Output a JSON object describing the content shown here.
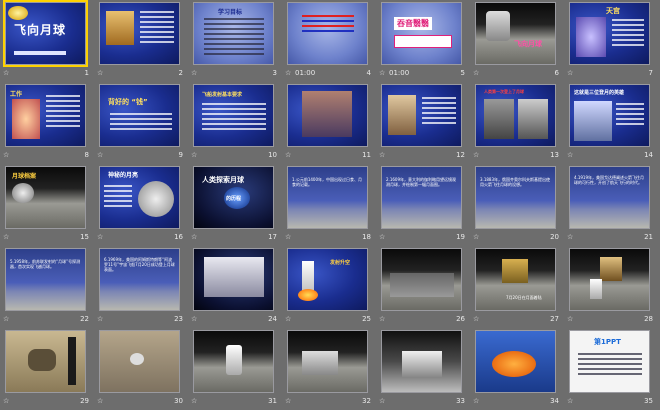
{
  "slides": [
    {
      "number": "1",
      "timing": "",
      "title": "飞向月球"
    },
    {
      "number": "2",
      "timing": ""
    },
    {
      "number": "3",
      "timing": "",
      "title": "学习目标"
    },
    {
      "number": "4",
      "timing": "01:00"
    },
    {
      "number": "5",
      "timing": "01:00",
      "title": "吞音翳翳"
    },
    {
      "number": "6",
      "timing": "",
      "title": "飞向月球"
    },
    {
      "number": "7",
      "timing": "",
      "title": "天宫"
    },
    {
      "number": "8",
      "timing": "",
      "title": "工作"
    },
    {
      "number": "9",
      "timing": "",
      "title": "背好的 “钱”"
    },
    {
      "number": "10",
      "timing": "",
      "title": "飞船发射基本要求"
    },
    {
      "number": "11",
      "timing": ""
    },
    {
      "number": "12",
      "timing": ""
    },
    {
      "number": "13",
      "timing": "",
      "title": "人类第一次登上了月球"
    },
    {
      "number": "14",
      "timing": "",
      "title": "这就是三位登月的英雄"
    },
    {
      "number": "15",
      "timing": "",
      "title": "月球档案"
    },
    {
      "number": "16",
      "timing": "",
      "title": "神秘的月亮"
    },
    {
      "number": "17",
      "timing": "",
      "title": "人类探索月球",
      "subtitle": "的历程"
    },
    {
      "number": "18",
      "timing": "",
      "text": "1.公元前1400年，中国出现过日食、月食的记载。"
    },
    {
      "number": "19",
      "timing": "",
      "text": "2.1609年，意大利的伽利略用望远镜观测月球，并绘制第一幅月面图。"
    },
    {
      "number": "20",
      "timing": "",
      "text": "3.1883年，俄国齐奥尔科夫斯基提出使用火箭飞往月球的设想。"
    },
    {
      "number": "21",
      "timing": "",
      "text": "4.1919年，美国戈达德阐述火箭飞往月球的可行性，开创了航天飞行的时代。"
    },
    {
      "number": "22",
      "timing": "",
      "text": "5.1958年，前苏联发射的“月球”号探测器，首次实现飞越月球。"
    },
    {
      "number": "23",
      "timing": "",
      "text": "6.1969年，美国的阿姆斯特朗等“阿波罗11号”宇宙飞船7月20日成功登上月球表面。"
    },
    {
      "number": "24",
      "timing": ""
    },
    {
      "number": "25",
      "timing": "",
      "title": "发射升空"
    },
    {
      "number": "26",
      "timing": ""
    },
    {
      "number": "27",
      "timing": "",
      "text": "7月20日在月面着陆"
    },
    {
      "number": "28",
      "timing": ""
    },
    {
      "number": "29",
      "timing": ""
    },
    {
      "number": "30",
      "timing": ""
    },
    {
      "number": "31",
      "timing": ""
    },
    {
      "number": "32",
      "timing": ""
    },
    {
      "number": "33",
      "timing": ""
    },
    {
      "number": "34",
      "timing": ""
    },
    {
      "number": "35",
      "timing": "",
      "title": "第1PPT"
    }
  ],
  "selected_slide": "1",
  "footer_icon": "☆"
}
